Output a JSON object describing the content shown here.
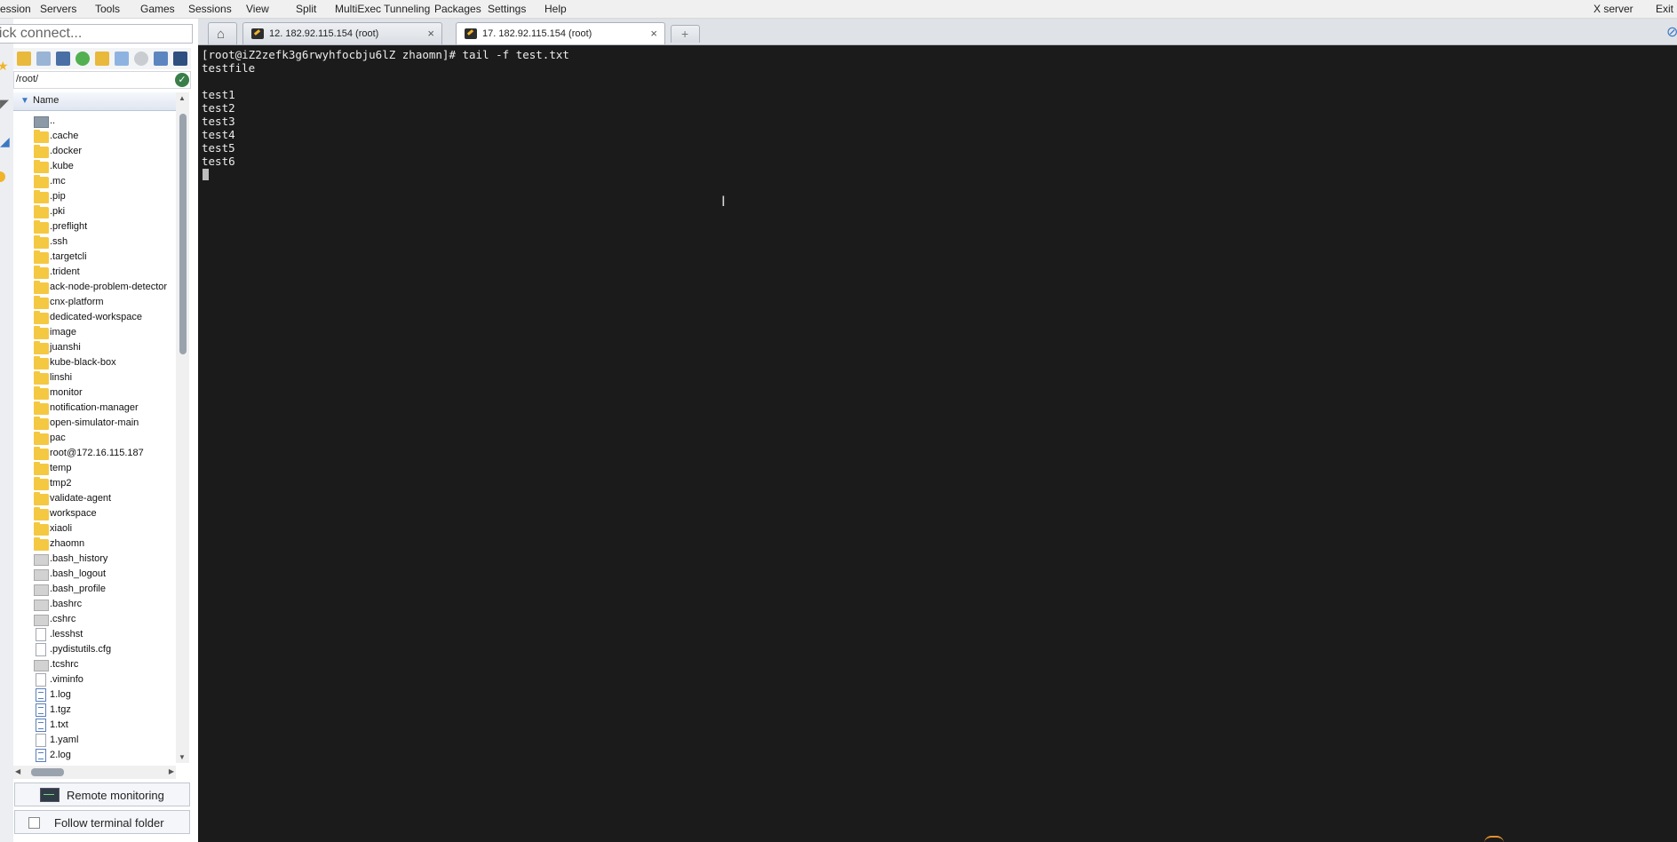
{
  "menubar": {
    "items": [
      "ession",
      "Servers",
      "Tools",
      "Games",
      "Sessions",
      "View",
      "Split",
      "MultiExec",
      "Tunneling",
      "Packages",
      "Settings",
      "Help"
    ],
    "right_items": [
      "X server",
      "Exit"
    ]
  },
  "sidebar": {
    "quick_connect_placeholder": "uick connect...",
    "path": "/root/",
    "column_header": "Name",
    "files": [
      {
        "name": "..",
        "type": "up"
      },
      {
        "name": ".cache",
        "type": "folder"
      },
      {
        "name": ".docker",
        "type": "folder"
      },
      {
        "name": ".kube",
        "type": "folder"
      },
      {
        "name": ".mc",
        "type": "folder"
      },
      {
        "name": ".pip",
        "type": "folder"
      },
      {
        "name": ".pki",
        "type": "folder"
      },
      {
        "name": ".preflight",
        "type": "folder"
      },
      {
        "name": ".ssh",
        "type": "folder"
      },
      {
        "name": ".targetcli",
        "type": "folder"
      },
      {
        "name": ".trident",
        "type": "folder"
      },
      {
        "name": "ack-node-problem-detector",
        "type": "folder"
      },
      {
        "name": "cnx-platform",
        "type": "folder"
      },
      {
        "name": "dedicated-workspace",
        "type": "folder"
      },
      {
        "name": "image",
        "type": "folder"
      },
      {
        "name": "juanshi",
        "type": "folder"
      },
      {
        "name": "kube-black-box",
        "type": "folder"
      },
      {
        "name": "linshi",
        "type": "folder"
      },
      {
        "name": "monitor",
        "type": "folder"
      },
      {
        "name": "notification-manager",
        "type": "folder"
      },
      {
        "name": "open-simulator-main",
        "type": "folder"
      },
      {
        "name": "pac",
        "type": "folder"
      },
      {
        "name": "root@172.16.115.187",
        "type": "folder"
      },
      {
        "name": "temp",
        "type": "folder"
      },
      {
        "name": "tmp2",
        "type": "folder"
      },
      {
        "name": "validate-agent",
        "type": "folder"
      },
      {
        "name": "workspace",
        "type": "folder"
      },
      {
        "name": "xiaoli",
        "type": "folder"
      },
      {
        "name": "zhaomn",
        "type": "folder"
      },
      {
        "name": ".bash_history",
        "type": "hidden"
      },
      {
        "name": ".bash_logout",
        "type": "hidden"
      },
      {
        "name": ".bash_profile",
        "type": "hidden"
      },
      {
        "name": ".bashrc",
        "type": "hidden"
      },
      {
        "name": ".cshrc",
        "type": "hidden"
      },
      {
        "name": ".lesshst",
        "type": "doc"
      },
      {
        "name": ".pydistutils.cfg",
        "type": "doc"
      },
      {
        "name": ".tcshrc",
        "type": "hidden"
      },
      {
        "name": ".viminfo",
        "type": "doc"
      },
      {
        "name": "1.log",
        "type": "log"
      },
      {
        "name": "1.tgz",
        "type": "log"
      },
      {
        "name": "1.txt",
        "type": "log"
      },
      {
        "name": "1.yaml",
        "type": "doc"
      },
      {
        "name": "2.log",
        "type": "log"
      }
    ],
    "remote_monitoring_label": "Remote monitoring",
    "follow_folder_label": "Follow terminal folder"
  },
  "tabs": [
    {
      "label": "12. 182.92.115.154 (root)",
      "active": false
    },
    {
      "label": "17. 182.92.115.154 (root)",
      "active": true
    }
  ],
  "terminal": {
    "lines": [
      "[root@iZ2zefk3g6rwyhfocbju6lZ zhaomn]# tail -f test.txt",
      "testfile",
      "",
      "test1",
      "test2",
      "test3",
      "test4",
      "test5",
      "test6"
    ]
  },
  "colors": {
    "terminal_bg": "#1b1b1b",
    "terminal_fg": "#ececec",
    "folder": "#f5c842",
    "accent": "#3b78c4"
  }
}
